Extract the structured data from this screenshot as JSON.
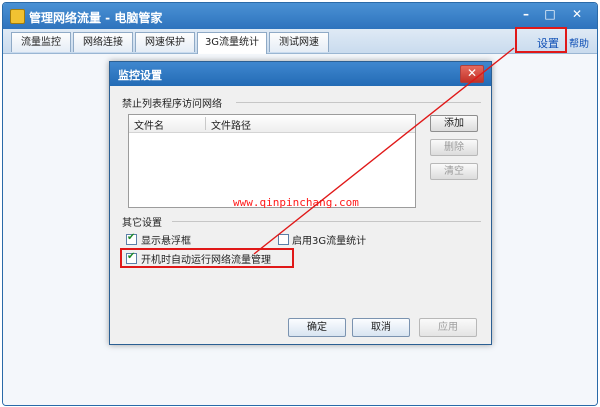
{
  "window": {
    "title": "管理网络流量 - 电脑管家",
    "minimize_glyph": "–",
    "maximize_glyph": "□",
    "close_glyph": "✕"
  },
  "tabs": [
    {
      "label": "流量监控"
    },
    {
      "label": "网络连接"
    },
    {
      "label": "网速保护"
    },
    {
      "label": "3G流量统计"
    },
    {
      "label": "测试网速"
    }
  ],
  "header_links": {
    "settings": "设置",
    "help": "帮助"
  },
  "dialog": {
    "title": "监控设置",
    "close_glyph": "✕",
    "block_section_label": "禁止列表程序访问网络",
    "list_columns": [
      "文件名",
      "文件路径"
    ],
    "buttons": {
      "add": "添加",
      "delete": "删除",
      "clear": "清空"
    },
    "other_section_label": "其它设置",
    "options": {
      "float_window": {
        "label": "显示悬浮框",
        "checked": true
      },
      "enable_3g": {
        "label": "启用3G流量统计",
        "checked": false
      },
      "autorun": {
        "label": "开机时自动运行网络流量管理",
        "checked": true
      }
    },
    "footer": {
      "ok": "确定",
      "cancel": "取消",
      "apply": "应用"
    }
  },
  "watermark": "www.qinpinchang.com",
  "colors": {
    "highlight": "#e01818",
    "titlebar": "#2e73bd",
    "link": "#0e4fb5"
  },
  "icons": {
    "app": "app-shield-icon",
    "check": "checkmark-icon"
  }
}
